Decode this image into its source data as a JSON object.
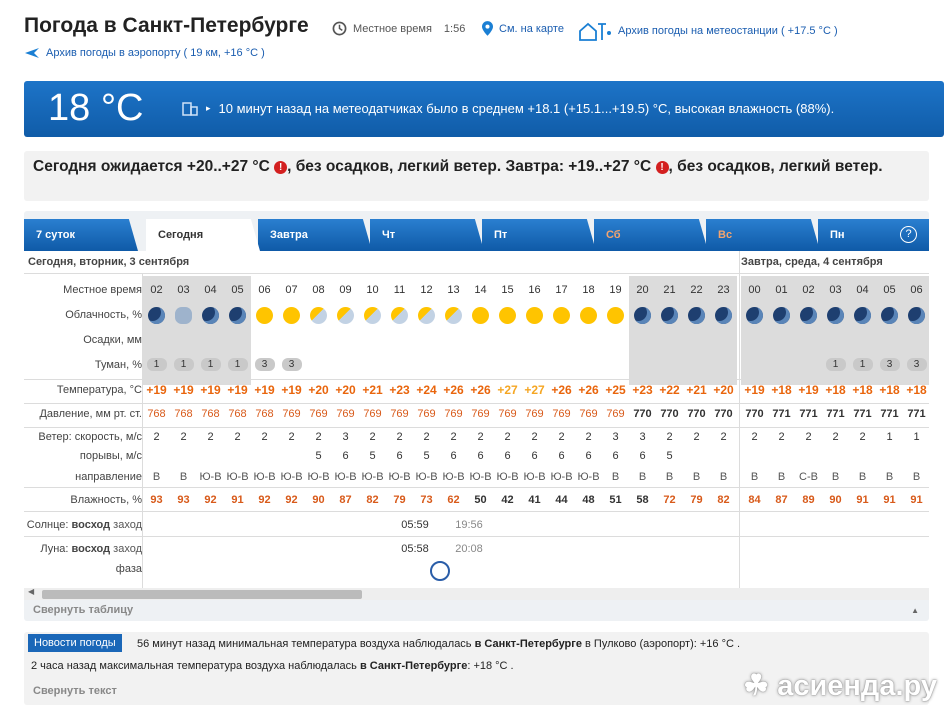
{
  "header": {
    "title": "Погода в Санкт-Петербурге",
    "local_time_label": "Местное время",
    "local_time": "1:56",
    "map_link": "См. на карте",
    "station_archive": "Архив погоды на метеостанции ( +17.5 °C )",
    "airport_archive": "Архив погоды в аэропорту ( 19 км, +16 °C )"
  },
  "banner": {
    "temp": "18 °C",
    "desc": "10 минут назад на метеодатчиках было в среднем +18.1 (+15.1...+19.5) °C, высокая влажность (88%)."
  },
  "forecast": {
    "p1": "Сегодня ожидается +20..+27 °C",
    "p2": ", без осадков, легкий ветер. Завтра: +19..+27 °C",
    "p3": ", без осадков, легкий ветер.",
    "warn_icon": "!"
  },
  "tabs": [
    {
      "label": "7 суток"
    },
    {
      "label": "Сегодня"
    },
    {
      "label": "Завтра"
    },
    {
      "label": "Чт"
    },
    {
      "label": "Пт"
    },
    {
      "label": "Сб"
    },
    {
      "label": "Вс"
    },
    {
      "label": "Пн"
    }
  ],
  "help": "?",
  "days": {
    "today": "Сегодня, вторник, 3 сентября",
    "tomorrow": "Завтра, среда, 4 сентября"
  },
  "labels": {
    "time": "Местное время",
    "cloud": "Облачность, %",
    "precip": "Осадки, мм",
    "fog": "Туман, %",
    "temp": "Температура, °C",
    "press": "Давление, мм рт. ст.",
    "wind": "Ветер: скорость, м/с",
    "gusts": "порывы, м/с",
    "dir": "направление",
    "hum": "Влажность, %",
    "sun_a": "Солнце: ",
    "sun_b": "восход",
    "sun_c": " заход",
    "moon_a": "Луна: ",
    "moon_b": "восход",
    "moon_c": " заход",
    "phase": "фаза"
  },
  "hours": [
    "02",
    "03",
    "04",
    "05",
    "06",
    "07",
    "08",
    "09",
    "10",
    "11",
    "12",
    "13",
    "14",
    "15",
    "16",
    "17",
    "18",
    "19",
    "20",
    "21",
    "22",
    "23",
    "00",
    "01",
    "02",
    "03",
    "04",
    "05",
    "06"
  ],
  "cloud": [
    "moon",
    "cl",
    "moon",
    "moon",
    "sun",
    "sun",
    "sc",
    "sc",
    "sc",
    "sc",
    "sc",
    "sc",
    "sun",
    "sun",
    "sun",
    "sun",
    "sun",
    "sun",
    "moon",
    "moon",
    "moon",
    "moon",
    "moon",
    "moon",
    "moon",
    "moon",
    "moon",
    "moon",
    "moon"
  ],
  "fog": [
    "1",
    "1",
    "1",
    "1",
    "3",
    "3",
    "",
    "",
    "",
    "",
    "",
    "",
    "",
    "",
    "",
    "",
    "",
    "",
    "",
    "",
    "",
    "",
    "",
    "",
    "",
    "1",
    "1",
    "3",
    "3"
  ],
  "temp": [
    "+19",
    "+19",
    "+19",
    "+19",
    "+19",
    "+19",
    "+20",
    "+20",
    "+21",
    "+23",
    "+24",
    "+26",
    "+26",
    "+27",
    "+27",
    "+26",
    "+26",
    "+25",
    "+23",
    "+22",
    "+21",
    "+20",
    "+19",
    "+18",
    "+19",
    "+18",
    "+18",
    "+18",
    "+18"
  ],
  "press": [
    "768",
    "768",
    "768",
    "768",
    "768",
    "769",
    "769",
    "769",
    "769",
    "769",
    "769",
    "769",
    "769",
    "769",
    "769",
    "769",
    "769",
    "769",
    "770",
    "770",
    "770",
    "770",
    "770",
    "771",
    "771",
    "771",
    "771",
    "771",
    "771"
  ],
  "wind": [
    "2",
    "2",
    "2",
    "2",
    "2",
    "2",
    "2",
    "3",
    "2",
    "2",
    "2",
    "2",
    "2",
    "2",
    "2",
    "2",
    "2",
    "3",
    "3",
    "2",
    "2",
    "2",
    "2",
    "2",
    "2",
    "2",
    "2",
    "1",
    "1"
  ],
  "gusts": [
    "",
    "",
    "",
    "",
    "",
    "",
    "5",
    "6",
    "5",
    "6",
    "5",
    "6",
    "6",
    "6",
    "6",
    "6",
    "6",
    "6",
    "6",
    "5",
    "",
    "",
    "",
    "",
    "",
    "",
    "",
    "",
    ""
  ],
  "dir": [
    "В",
    "В",
    "Ю-В",
    "Ю-В",
    "Ю-В",
    "Ю-В",
    "Ю-В",
    "Ю-В",
    "Ю-В",
    "Ю-В",
    "Ю-В",
    "Ю-В",
    "Ю-В",
    "Ю-В",
    "Ю-В",
    "Ю-В",
    "Ю-В",
    "В",
    "В",
    "В",
    "В",
    "В",
    "В",
    "В",
    "С-В",
    "В",
    "В",
    "В",
    "В"
  ],
  "hum": [
    "93",
    "93",
    "92",
    "91",
    "92",
    "92",
    "90",
    "87",
    "82",
    "79",
    "73",
    "62",
    "50",
    "42",
    "41",
    "44",
    "48",
    "51",
    "58",
    "72",
    "79",
    "82",
    "84",
    "87",
    "89",
    "90",
    "91",
    "91",
    "91"
  ],
  "sun": {
    "rise": "05:59",
    "set": "19:56"
  },
  "moon": {
    "rise": "05:58",
    "set": "20:08"
  },
  "collapse_table": "Свернуть таблицу",
  "news": {
    "button": "Новости погоды",
    "line1_a": "56 минут назад минимальная температура воздуха наблюдалась ",
    "line1_b": "в Санкт-Петербурге",
    "line1_c": " в Пулково (аэропорт): +16 °C .",
    "line2_a": "2 часа назад максимальная температура воздуха наблюдалась ",
    "line2_b": "в Санкт-Петербурге",
    "line2_c": ": +18 °C .",
    "collapse": "Свернуть текст"
  },
  "watermark": "асиенда.ру"
}
